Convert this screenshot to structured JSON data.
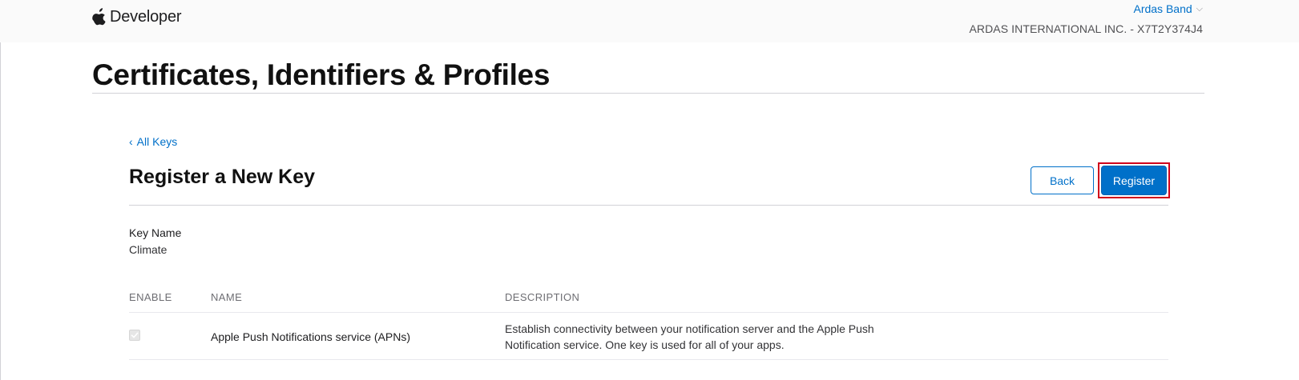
{
  "header": {
    "brand": "Developer",
    "account_name": "Ardas Band",
    "team": "ARDAS INTERNATIONAL INC. - X7T2Y374J4"
  },
  "page": {
    "title": "Certificates, Identifiers & Profiles"
  },
  "breadcrumb": {
    "back_label": "All Keys"
  },
  "form": {
    "title": "Register a New Key",
    "back_button": "Back",
    "register_button": "Register",
    "key_name_label": "Key Name",
    "key_name_value": "Climate"
  },
  "table": {
    "columns": [
      "ENABLE",
      "NAME",
      "DESCRIPTION"
    ],
    "rows": [
      {
        "enabled": true,
        "disabled": true,
        "name": "Apple Push Notifications service (APNs)",
        "description": "Establish connectivity between your notification server and the Apple Push Notification service. One key is used for all of your apps."
      }
    ]
  },
  "colors": {
    "link": "#0070c9",
    "primary_button": "#0070c9",
    "highlight": "#d0021b"
  }
}
